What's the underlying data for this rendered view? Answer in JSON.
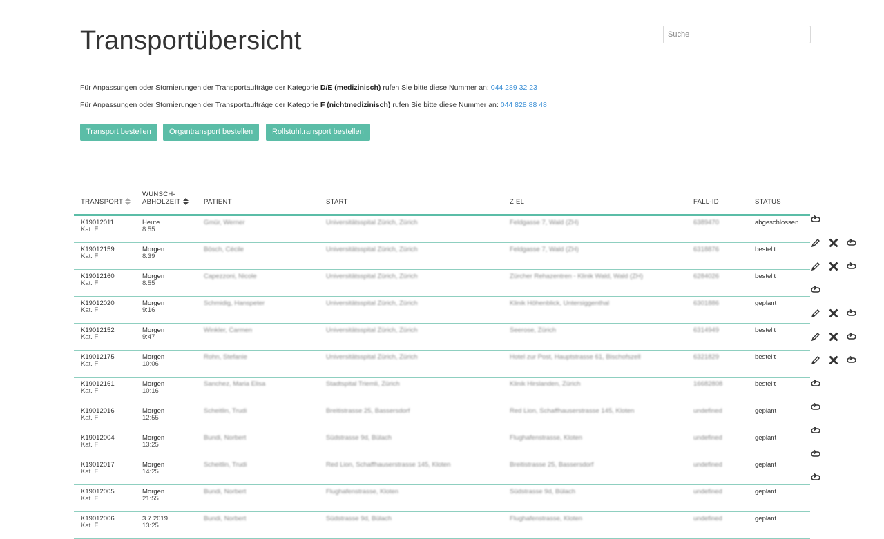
{
  "header": {
    "title": "Transportübersicht",
    "search_placeholder": "Suche"
  },
  "info": {
    "line1": {
      "prefix": "Für Anpassungen oder Stornierungen der Transportaufträge der Kategorie ",
      "category": "D/E (medizinisch)",
      "middle": " rufen Sie bitte diese Nummer an: ",
      "phone": "044 289 32 23"
    },
    "line2": {
      "prefix": "Für Anpassungen oder Stornierungen der Transportaufträge der Kategorie ",
      "category": "F (nichtmedizinisch)",
      "middle": " rufen Sie bitte diese Nummer an: ",
      "phone": "044 828 88 48"
    }
  },
  "buttons": {
    "transport": "Transport bestellen",
    "organ": "Organtransport bestellen",
    "rollstuhl": "Rollstuhltransport bestellen"
  },
  "table": {
    "headers": {
      "transport": "TRANSPORT",
      "wunsch1": "WUNSCH-",
      "wunsch2": "ABHOLZEIT",
      "patient": "PATIENT",
      "start": "START",
      "ziel": "ZIEL",
      "fall": "FALL-ID",
      "status": "STATUS"
    },
    "rows": [
      {
        "id": "K19012011",
        "kat": "Kat. F",
        "day": "Heute",
        "time": "8:55",
        "patient": "Gmür, Werner",
        "start": "Universitätsspital Zürich, Zürich",
        "ziel": "Feldgasse 7, Wald (ZH)",
        "fall": "6389470",
        "status": "abgeschlossen",
        "editable": false
      },
      {
        "id": "K19012159",
        "kat": "Kat. F",
        "day": "Morgen",
        "time": "8:39",
        "patient": "Bösch, Cécile",
        "start": "Universitätsspital Zürich, Zürich",
        "ziel": "Feldgasse 7, Wald (ZH)",
        "fall": "6318876",
        "status": "bestellt",
        "editable": true
      },
      {
        "id": "K19012160",
        "kat": "Kat. F",
        "day": "Morgen",
        "time": "8:55",
        "patient": "Capezzoni, Nicole",
        "start": "Universitätsspital Zürich, Zürich",
        "ziel": "Zürcher Rehazentren - Klinik Wald, Wald (ZH)",
        "fall": "6284026",
        "status": "bestellt",
        "editable": true
      },
      {
        "id": "K19012020",
        "kat": "Kat. F",
        "day": "Morgen",
        "time": "9:16",
        "patient": "Schmidig, Hanspeter",
        "start": "Universitätsspital Zürich, Zürich",
        "ziel": "Klinik Höhenblick, Untersiggenthal",
        "fall": "6301886",
        "status": "geplant",
        "editable": false
      },
      {
        "id": "K19012152",
        "kat": "Kat. F",
        "day": "Morgen",
        "time": "9:47",
        "patient": "Winkler, Carmen",
        "start": "Universitätsspital Zürich, Zürich",
        "ziel": "Seerose, Zürich",
        "fall": "6314949",
        "status": "bestellt",
        "editable": true
      },
      {
        "id": "K19012175",
        "kat": "Kat. F",
        "day": "Morgen",
        "time": "10:06",
        "patient": "Rohn, Stefanie",
        "start": "Universitätsspital Zürich, Zürich",
        "ziel": "Hotel zur Post, Hauptstrasse 61, Bischofszell",
        "fall": "6321829",
        "status": "bestellt",
        "editable": true
      },
      {
        "id": "K19012161",
        "kat": "Kat. F",
        "day": "Morgen",
        "time": "10:16",
        "patient": "Sanchez, Maria Elisa",
        "start": "Stadtspital Triemli, Zürich",
        "ziel": "Klinik Hirslanden, Zürich",
        "fall": "16682808",
        "status": "bestellt",
        "editable": true
      },
      {
        "id": "K19012016",
        "kat": "Kat. F",
        "day": "Morgen",
        "time": "12:55",
        "patient": "Scheitlin, Trudi",
        "start": "Breitistrasse 25, Bassersdorf",
        "ziel": "Red Lion, Schaffhauserstrasse 145, Kloten",
        "fall": "undefined",
        "status": "geplant",
        "editable": false
      },
      {
        "id": "K19012004",
        "kat": "Kat. F",
        "day": "Morgen",
        "time": "13:25",
        "patient": "Bundi, Norbert",
        "start": "Südstrasse 9d, Bülach",
        "ziel": "Flughafenstrasse, Kloten",
        "fall": "undefined",
        "status": "geplant",
        "editable": false
      },
      {
        "id": "K19012017",
        "kat": "Kat. F",
        "day": "Morgen",
        "time": "14:25",
        "patient": "Scheitlin, Trudi",
        "start": "Red Lion, Schaffhauserstrasse 145, Kloten",
        "ziel": "Breitistrasse 25, Bassersdorf",
        "fall": "undefined",
        "status": "geplant",
        "editable": false
      },
      {
        "id": "K19012005",
        "kat": "Kat. F",
        "day": "Morgen",
        "time": "21:55",
        "patient": "Bundi, Norbert",
        "start": "Flughafenstrasse, Kloten",
        "ziel": "Südstrasse 9d, Bülach",
        "fall": "undefined",
        "status": "geplant",
        "editable": false
      },
      {
        "id": "K19012006",
        "kat": "Kat. F",
        "day": "3.7.2019",
        "time": "13:25",
        "patient": "Bundi, Norbert",
        "start": "Südstrasse 9d, Bülach",
        "ziel": "Flughafenstrasse, Kloten",
        "fall": "undefined",
        "status": "geplant",
        "editable": false
      }
    ]
  },
  "icons": {
    "edit": "pencil-icon",
    "delete": "cross-icon",
    "repeat": "repeat-icon"
  },
  "colors": {
    "accent": "#5bbda7",
    "link": "#3a8fd6"
  }
}
